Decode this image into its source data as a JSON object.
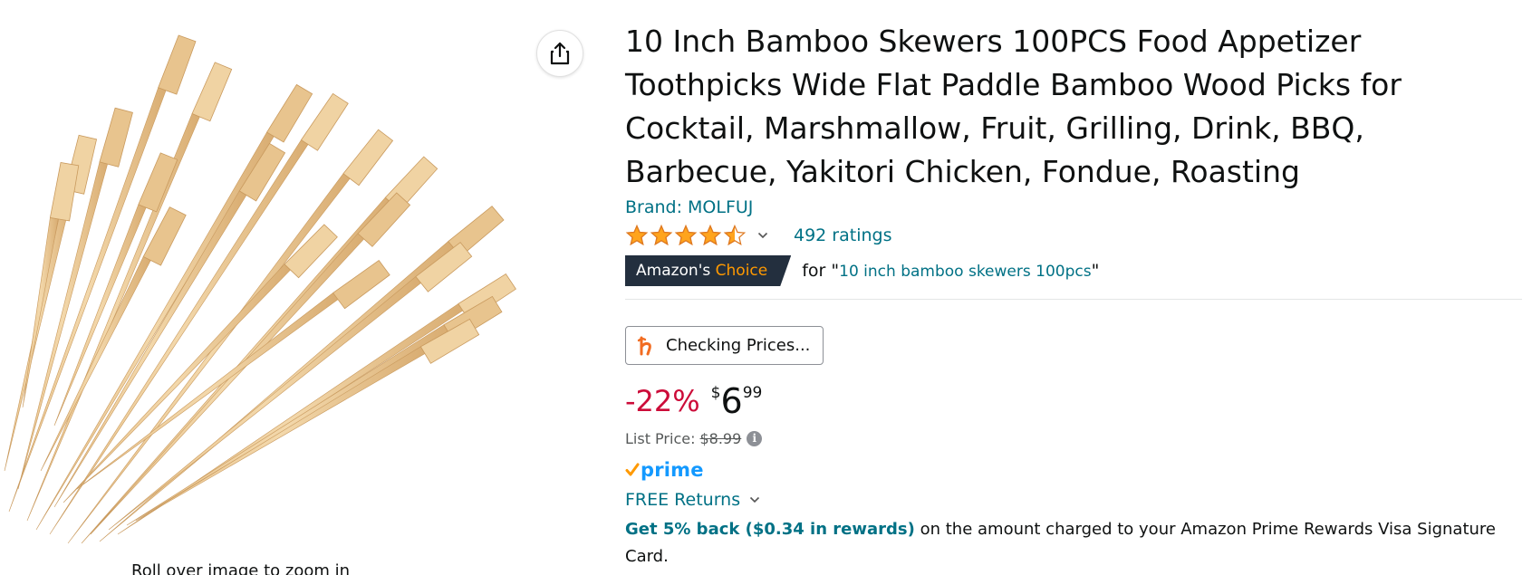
{
  "image": {
    "caption": "Roll over image to zoom in",
    "share_icon": "share-icon"
  },
  "product": {
    "title": "10 Inch Bamboo Skewers 100PCS Food Appetizer Toothpicks Wide Flat Paddle Bamboo Wood Picks for Cocktail, Marshmallow, Fruit, Grilling, Drink, BBQ, Barbecue, Yakitori Chicken, Fondue, Roasting",
    "brand": "Brand: MOLFUJ",
    "rating": {
      "stars": 4.5,
      "max_stars": 5,
      "ratings_text": "492 ratings",
      "star_color": "#FFA41C"
    }
  },
  "choice": {
    "badge_prefix": "Amazon's",
    "badge_word": "Choice",
    "for_text": "for",
    "query": "10 inch bamboo skewers 100pcs"
  },
  "honey": {
    "label": "Checking Prices...",
    "icon": "honey-h-icon"
  },
  "price": {
    "discount": "-22%",
    "symbol": "$",
    "whole": "6",
    "fraction": "99",
    "list_price_label": "List Price:",
    "list_price_value": "$8.99",
    "info_icon": "i"
  },
  "prime": {
    "label": "prime"
  },
  "returns": {
    "label": "FREE Returns"
  },
  "rewards": {
    "link_text": "Get 5% back ($0.34 in rewards)",
    "rest_text": " on the amount charged to your Amazon Prime Rewards Visa Signature Card."
  },
  "colors": {
    "link": "#007185",
    "discount": "#CC0C39",
    "prime_blue": "#1399FF",
    "badge_bg": "#232F3E",
    "badge_accent": "#FF9900"
  }
}
